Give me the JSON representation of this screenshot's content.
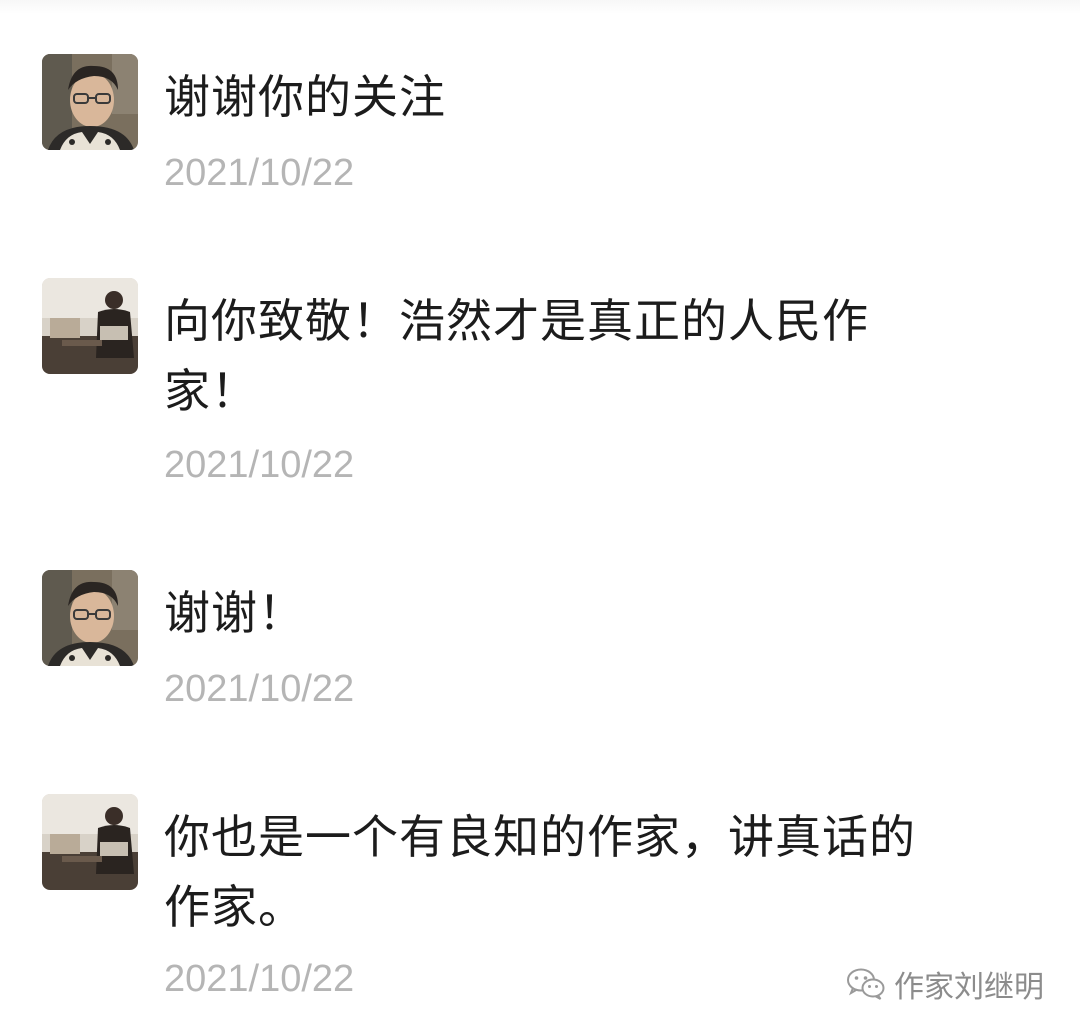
{
  "comments": [
    {
      "author_avatar": "avatar-portrait-glasses",
      "text": "谢谢你的关注",
      "date": "2021/10/22"
    },
    {
      "author_avatar": "avatar-seated-person-room",
      "text": "向你致敬！浩然才是真正的人民作\n家！",
      "date": "2021/10/22"
    },
    {
      "author_avatar": "avatar-portrait-glasses",
      "text": "谢谢！",
      "date": "2021/10/22"
    },
    {
      "author_avatar": "avatar-seated-person-room",
      "text": "你也是一个有良知的作家，讲真话的\n作家。",
      "date": "2021/10/22"
    }
  ],
  "watermark": {
    "icon": "wechat-icon",
    "label": "作家刘继明"
  },
  "colors": {
    "text": "#1c1c1c",
    "date": "#b5b5b5",
    "watermark": "#8c8c8c"
  }
}
